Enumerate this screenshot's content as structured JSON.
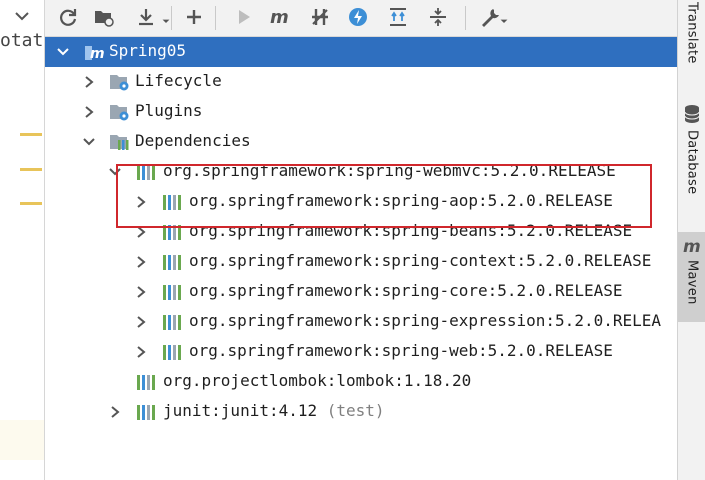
{
  "editor": {
    "fragment": "otat"
  },
  "toolbar": {
    "buttons": [
      {
        "name": "reload-icon"
      },
      {
        "name": "folder-sync-icon"
      },
      {
        "name": "download-icon"
      },
      {
        "name": "add-icon"
      },
      {
        "name": "run-icon"
      },
      {
        "name": "maven-goal-icon"
      },
      {
        "name": "skip-tests-icon"
      },
      {
        "name": "offline-icon"
      },
      {
        "name": "show-dependencies-icon"
      },
      {
        "name": "collapse-all-icon"
      },
      {
        "name": "settings-wrench-icon"
      }
    ]
  },
  "tree": {
    "project": "Spring05",
    "lifecycle": "Lifecycle",
    "plugins": "Plugins",
    "dependencies": "Dependencies",
    "webmvc": "org.springframework:spring-webmvc:5.2.0.RELEASE",
    "children": [
      "org.springframework:spring-aop:5.2.0.RELEASE",
      "org.springframework:spring-beans:5.2.0.RELEASE",
      "org.springframework:spring-context:5.2.0.RELEASE",
      "org.springframework:spring-core:5.2.0.RELEASE",
      "org.springframework:spring-expression:5.2.0.RELEA",
      "org.springframework:spring-web:5.2.0.RELEASE"
    ],
    "lombok": "org.projectlombok:lombok:1.18.20",
    "junit": "junit:junit:4.12",
    "junit_scope": "(test)"
  },
  "side_tabs": {
    "translate": "Translate",
    "database": "Database",
    "maven": "Maven"
  },
  "colors": {
    "selection": "#2f6fbf",
    "highlight_box": "#d0272c",
    "maven_blue": "#3d8fd6"
  }
}
